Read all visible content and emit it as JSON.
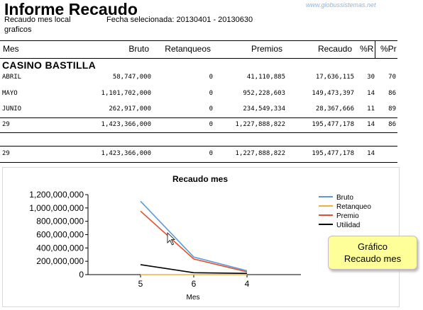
{
  "report": {
    "title": "Informe Recaudo",
    "watermark": "www.globussistemas.net",
    "subtitle_left": "Recaudo mes local",
    "subtitle_left2": "graficos",
    "date_label": "Fecha selecionada: 20130401 - 20130630"
  },
  "table": {
    "headers": [
      "Mes",
      "Bruto",
      "Retanqueos",
      "Premios",
      "Recaudo",
      "%R",
      "%Pr"
    ],
    "group_name": "CASINO BASTILLA",
    "rows": [
      {
        "mes": "ABRIL",
        "bruto": "58,747,000",
        "retanqueos": "0",
        "premios": "41,110,885",
        "recaudo": "17,636,115",
        "r": "30",
        "pr": "70"
      },
      {
        "mes": "MAYO",
        "bruto": "1,101,702,000",
        "retanqueos": "0",
        "premios": "952,228,603",
        "recaudo": "149,473,397",
        "r": "14",
        "pr": "86"
      },
      {
        "mes": "JUNIO",
        "bruto": "262,917,000",
        "retanqueos": "0",
        "premios": "234,549,334",
        "recaudo": "28,367,666",
        "r": "11",
        "pr": "89"
      }
    ],
    "subtotal": {
      "mes": "29",
      "bruto": "1,423,366,000",
      "retanqueos": "0",
      "premios": "1,227,888,822",
      "recaudo": "195,477,178",
      "r": "14",
      "pr": "86"
    },
    "total": {
      "mes": "29",
      "bruto": "1,423,366,000",
      "retanqueos": "0",
      "premios": "1,227,888,822",
      "recaudo": "195,477,178",
      "r": "14"
    }
  },
  "callout": {
    "line1": "Gráfico",
    "line2": "Recaudo mes"
  },
  "chart_data": {
    "type": "line",
    "title": "Recaudo mes",
    "xlabel": "Mes",
    "ylabel": "",
    "categories": [
      "5",
      "6",
      "4"
    ],
    "ylim": [
      0,
      1200000000
    ],
    "yticks": [
      "0",
      "200,000,000",
      "400,000,000",
      "600,000,000",
      "800,000,000",
      "1,000,000,000",
      "1,200,000,000"
    ],
    "legend_position": "right",
    "grid": false,
    "series": [
      {
        "name": "Bruto",
        "color": "#5b9bd5",
        "values": [
          1101702000,
          262917000,
          58747000
        ]
      },
      {
        "name": "Retanqueo",
        "color": "#f0b040",
        "values": [
          0,
          0,
          0
        ]
      },
      {
        "name": "Premio",
        "color": "#e0502a",
        "values": [
          952228603,
          234549334,
          41110885
        ]
      },
      {
        "name": "Utilidad",
        "color": "#000000",
        "values": [
          149473397,
          28367666,
          17636115
        ]
      }
    ]
  }
}
